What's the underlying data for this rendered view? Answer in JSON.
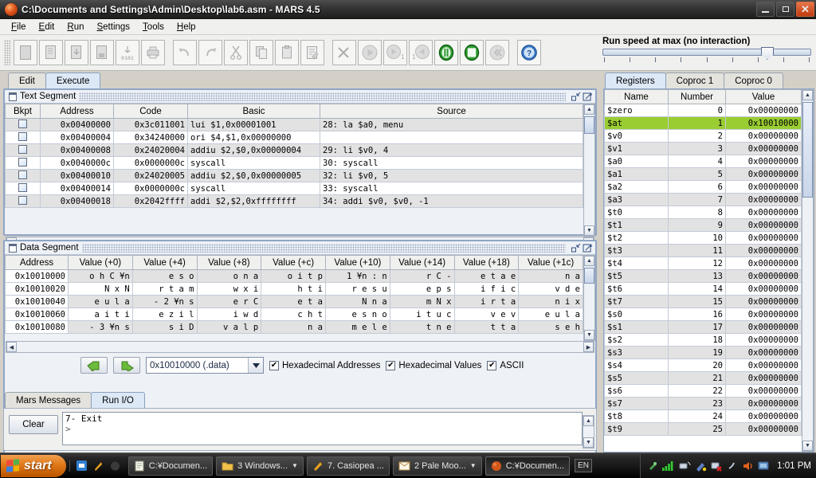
{
  "window": {
    "title": "C:\\Documents and Settings\\Admin\\Desktop\\lab6.asm  - MARS 4.5",
    "minimize": "_",
    "maximize": "❐",
    "close": "✕",
    "app_icon": "mars-planet-icon"
  },
  "menu": {
    "items": [
      "File",
      "Edit",
      "Run",
      "Settings",
      "Tools",
      "Help"
    ]
  },
  "toolbar": {
    "buttons": [
      {
        "name": "new-file",
        "icon": "blank-page-icon",
        "enabled": false
      },
      {
        "name": "open-file",
        "icon": "folder-page-icon",
        "enabled": false
      },
      {
        "name": "save-file",
        "icon": "save-disk-icon",
        "enabled": false
      },
      {
        "name": "save-as-file",
        "icon": "save-as-icon",
        "enabled": false
      },
      {
        "name": "dump-memory",
        "icon": "binary-0101-icon",
        "enabled": false
      },
      {
        "name": "print",
        "icon": "printer-icon",
        "enabled": false
      },
      {
        "name": "undo",
        "icon": "undo-arrow-icon",
        "enabled": false
      },
      {
        "name": "redo",
        "icon": "redo-arrow-icon",
        "enabled": false
      },
      {
        "name": "cut",
        "icon": "scissors-icon",
        "enabled": false
      },
      {
        "name": "copy",
        "icon": "copy-pages-icon",
        "enabled": false
      },
      {
        "name": "paste",
        "icon": "clipboard-icon",
        "enabled": false
      },
      {
        "name": "find-replace",
        "icon": "find-replace-icon",
        "enabled": false
      },
      {
        "name": "assemble",
        "icon": "wrench-screwdriver-icon",
        "enabled": false
      },
      {
        "name": "run",
        "icon": "play-triangle-icon",
        "enabled": false
      },
      {
        "name": "step-forward",
        "icon": "step-forward-icon",
        "enabled": false
      },
      {
        "name": "step-backward",
        "icon": "step-backward-icon",
        "enabled": false
      },
      {
        "name": "pause",
        "icon": "pause-icon",
        "enabled": true
      },
      {
        "name": "stop",
        "icon": "stop-square-icon",
        "enabled": true
      },
      {
        "name": "reset",
        "icon": "rewind-icon",
        "enabled": false
      },
      {
        "name": "help",
        "icon": "question-mark-icon",
        "enabled": true
      }
    ]
  },
  "run_speed": {
    "label": "Run speed at max (no interaction)",
    "value_percent": 100,
    "tick_count": 9
  },
  "tabs": {
    "edit": "Edit",
    "execute": "Execute",
    "active": "Execute"
  },
  "text_segment": {
    "title": "Text Segment",
    "columns": [
      "Bkpt",
      "Address",
      "Code",
      "Basic",
      "Source"
    ],
    "rows": [
      {
        "bkpt": "",
        "address": "0x00400000",
        "code": "0x3c011001",
        "basic": "lui $1,0x00001001",
        "source": "28:       la $a0, menu"
      },
      {
        "bkpt": "",
        "address": "0x00400004",
        "code": "0x34240000",
        "basic": "ori $4,$1,0x00000000",
        "source": ""
      },
      {
        "bkpt": "",
        "address": "0x00400008",
        "code": "0x24020004",
        "basic": "addiu $2,$0,0x00000004",
        "source": "29:       li $v0, 4"
      },
      {
        "bkpt": "",
        "address": "0x0040000c",
        "code": "0x0000000c",
        "basic": "syscall",
        "source": "30:       syscall"
      },
      {
        "bkpt": "",
        "address": "0x00400010",
        "code": "0x24020005",
        "basic": "addiu $2,$0,0x00000005",
        "source": "32:       li $v0, 5"
      },
      {
        "bkpt": "",
        "address": "0x00400014",
        "code": "0x0000000c",
        "basic": "syscall",
        "source": "33:       syscall"
      },
      {
        "bkpt": "",
        "address": "0x00400018",
        "code": "0x2042ffff",
        "basic": "addi $2,$2,0xffffffff",
        "source": "34:       addi $v0, $v0, -1"
      }
    ]
  },
  "data_segment": {
    "title": "Data Segment",
    "columns": [
      "Address",
      "Value (+0)",
      "Value (+4)",
      "Value (+8)",
      "Value (+c)",
      "Value (+10)",
      "Value (+14)",
      "Value (+18)",
      "Value (+1c)"
    ],
    "rows": [
      {
        "address": "0x10010000",
        "values": [
          "o h  C ¥n",
          "    e  s  o",
          "o     n  a",
          "o  i  t  p",
          "1 ¥n  :  n",
          "r  C       -",
          "e  t  a  e",
          "   n  a"
        ]
      },
      {
        "address": "0x10010020",
        "values": [
          "   N  x  N",
          "r  t  a  m",
          "w     x  i",
          "   h  t  i",
          "r  e  s  u",
          "e  p  s",
          "   i  f  i  c",
          "v     d  e"
        ]
      },
      {
        "address": "0x10010040",
        "values": [
          "e  u  l  a",
          "-  2 ¥n  s",
          "e  r  C",
          "   e  t  a",
          "N     n  a",
          "m     N  x",
          "i  r  t  a",
          "n  i     x"
        ]
      },
      {
        "address": "0x10010060",
        "values": [
          "a  i  t  i",
          "e  z  i  l",
          "i  w     d",
          "c     h  t",
          "e  s  n  o",
          "i  t  u  c",
          "v     e  v",
          "e  u  l  a"
        ]
      },
      {
        "address": "0x10010080",
        "values": [
          "-  3 ¥n  s",
          "s  i  D",
          "v  a  l  p",
          "n  a",
          "m  e  l  e",
          "t  n  e",
          "t     t  a",
          "s     e  h"
        ]
      }
    ],
    "controls": {
      "prev_label": "prev-arrow",
      "next_label": "next-arrow",
      "selected_segment": "0x10010000 (.data)",
      "checkboxes": [
        {
          "label": "Hexadecimal Addresses",
          "checked": true
        },
        {
          "label": "Hexadecimal Values",
          "checked": true
        },
        {
          "label": "ASCII",
          "checked": true
        }
      ]
    }
  },
  "messages": {
    "tabs": [
      "Mars Messages",
      "Run I/O"
    ],
    "active_tab": "Run I/O",
    "clear_button": "Clear",
    "console_text": "7- Exit"
  },
  "registers": {
    "tabs": [
      "Registers",
      "Coproc 1",
      "Coproc 0"
    ],
    "active_tab": "Registers",
    "columns": [
      "Name",
      "Number",
      "Value"
    ],
    "highlight_color": "#9acd32",
    "rows": [
      {
        "name": "$zero",
        "number": "0",
        "value": "0x00000000",
        "selected": false
      },
      {
        "name": "$at",
        "number": "1",
        "value": "0x10010000",
        "selected": true
      },
      {
        "name": "$v0",
        "number": "2",
        "value": "0x00000000",
        "selected": false
      },
      {
        "name": "$v1",
        "number": "3",
        "value": "0x00000000",
        "selected": false
      },
      {
        "name": "$a0",
        "number": "4",
        "value": "0x00000000",
        "selected": false
      },
      {
        "name": "$a1",
        "number": "5",
        "value": "0x00000000",
        "selected": false
      },
      {
        "name": "$a2",
        "number": "6",
        "value": "0x00000000",
        "selected": false
      },
      {
        "name": "$a3",
        "number": "7",
        "value": "0x00000000",
        "selected": false
      },
      {
        "name": "$t0",
        "number": "8",
        "value": "0x00000000",
        "selected": false
      },
      {
        "name": "$t1",
        "number": "9",
        "value": "0x00000000",
        "selected": false
      },
      {
        "name": "$t2",
        "number": "10",
        "value": "0x00000000",
        "selected": false
      },
      {
        "name": "$t3",
        "number": "11",
        "value": "0x00000000",
        "selected": false
      },
      {
        "name": "$t4",
        "number": "12",
        "value": "0x00000000",
        "selected": false
      },
      {
        "name": "$t5",
        "number": "13",
        "value": "0x00000000",
        "selected": false
      },
      {
        "name": "$t6",
        "number": "14",
        "value": "0x00000000",
        "selected": false
      },
      {
        "name": "$t7",
        "number": "15",
        "value": "0x00000000",
        "selected": false
      },
      {
        "name": "$s0",
        "number": "16",
        "value": "0x00000000",
        "selected": false
      },
      {
        "name": "$s1",
        "number": "17",
        "value": "0x00000000",
        "selected": false
      },
      {
        "name": "$s2",
        "number": "18",
        "value": "0x00000000",
        "selected": false
      },
      {
        "name": "$s3",
        "number": "19",
        "value": "0x00000000",
        "selected": false
      },
      {
        "name": "$s4",
        "number": "20",
        "value": "0x00000000",
        "selected": false
      },
      {
        "name": "$s5",
        "number": "21",
        "value": "0x00000000",
        "selected": false
      },
      {
        "name": "$s6",
        "number": "22",
        "value": "0x00000000",
        "selected": false
      },
      {
        "name": "$s7",
        "number": "23",
        "value": "0x00000000",
        "selected": false
      },
      {
        "name": "$t8",
        "number": "24",
        "value": "0x00000000",
        "selected": false
      },
      {
        "name": "$t9",
        "number": "25",
        "value": "0x00000000",
        "selected": false
      }
    ]
  },
  "taskbar": {
    "start_label": "start",
    "quick_launch": [
      "outlook-express-icon",
      "pale-moon-icon",
      "opera-icon"
    ],
    "items": [
      {
        "label": "C:¥Documen...",
        "icon": "notepad-icon",
        "has_arrow": false,
        "active": false
      },
      {
        "label": "3 Windows...",
        "icon": "folder-icon",
        "has_arrow": true,
        "active": false
      },
      {
        "label": "7. Casiopea ...",
        "icon": "media-icon",
        "has_arrow": false,
        "active": false
      },
      {
        "label": "2 Pale Moo...",
        "icon": "envelope-icon",
        "has_arrow": true,
        "active": false
      },
      {
        "label": "C:¥Documen...",
        "icon": "mars-planet-icon",
        "has_arrow": false,
        "active": true
      }
    ],
    "language": "EN",
    "tray_icons": [
      "usb-icon",
      "signal-bars-icon",
      "network-icon",
      "antivirus-icon",
      "network-error-icon",
      "shield-icon",
      "volume-icon",
      "display-icon"
    ],
    "clock": "1:01 PM"
  }
}
